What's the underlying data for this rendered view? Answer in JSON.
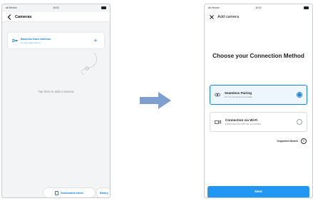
{
  "status_bar": {
    "carrier": "all Service",
    "time": "16:02"
  },
  "left_screen": {
    "title": "Cameras",
    "camera_card": {
      "title": "BlackVue Dash Cameras",
      "subtitle": "For easy dash-sharing"
    },
    "hint": "Tap here to add a camera",
    "downloaded_videos_label": "Downloaded videos",
    "battery_label": "Battery"
  },
  "right_screen": {
    "title": "Add camera",
    "heading": "Choose your Connection Method",
    "options": [
      {
        "title": "Seamless Pairing",
        "subtitle": "All X Series Models Compatible",
        "selected": true,
        "icon": "link-icon"
      },
      {
        "title": "Connection via Wi-Fi",
        "subtitle": "DR900X/DR750X/DR770X and DR590X",
        "selected": false,
        "icon": "wifi-camera-icon"
      }
    ],
    "supported_models_label": "Supported Models",
    "next_label": "Next"
  },
  "colors": {
    "accent": "#1a7fd6",
    "next_button": "#2196f3",
    "arrow": "#7f9fd0"
  }
}
